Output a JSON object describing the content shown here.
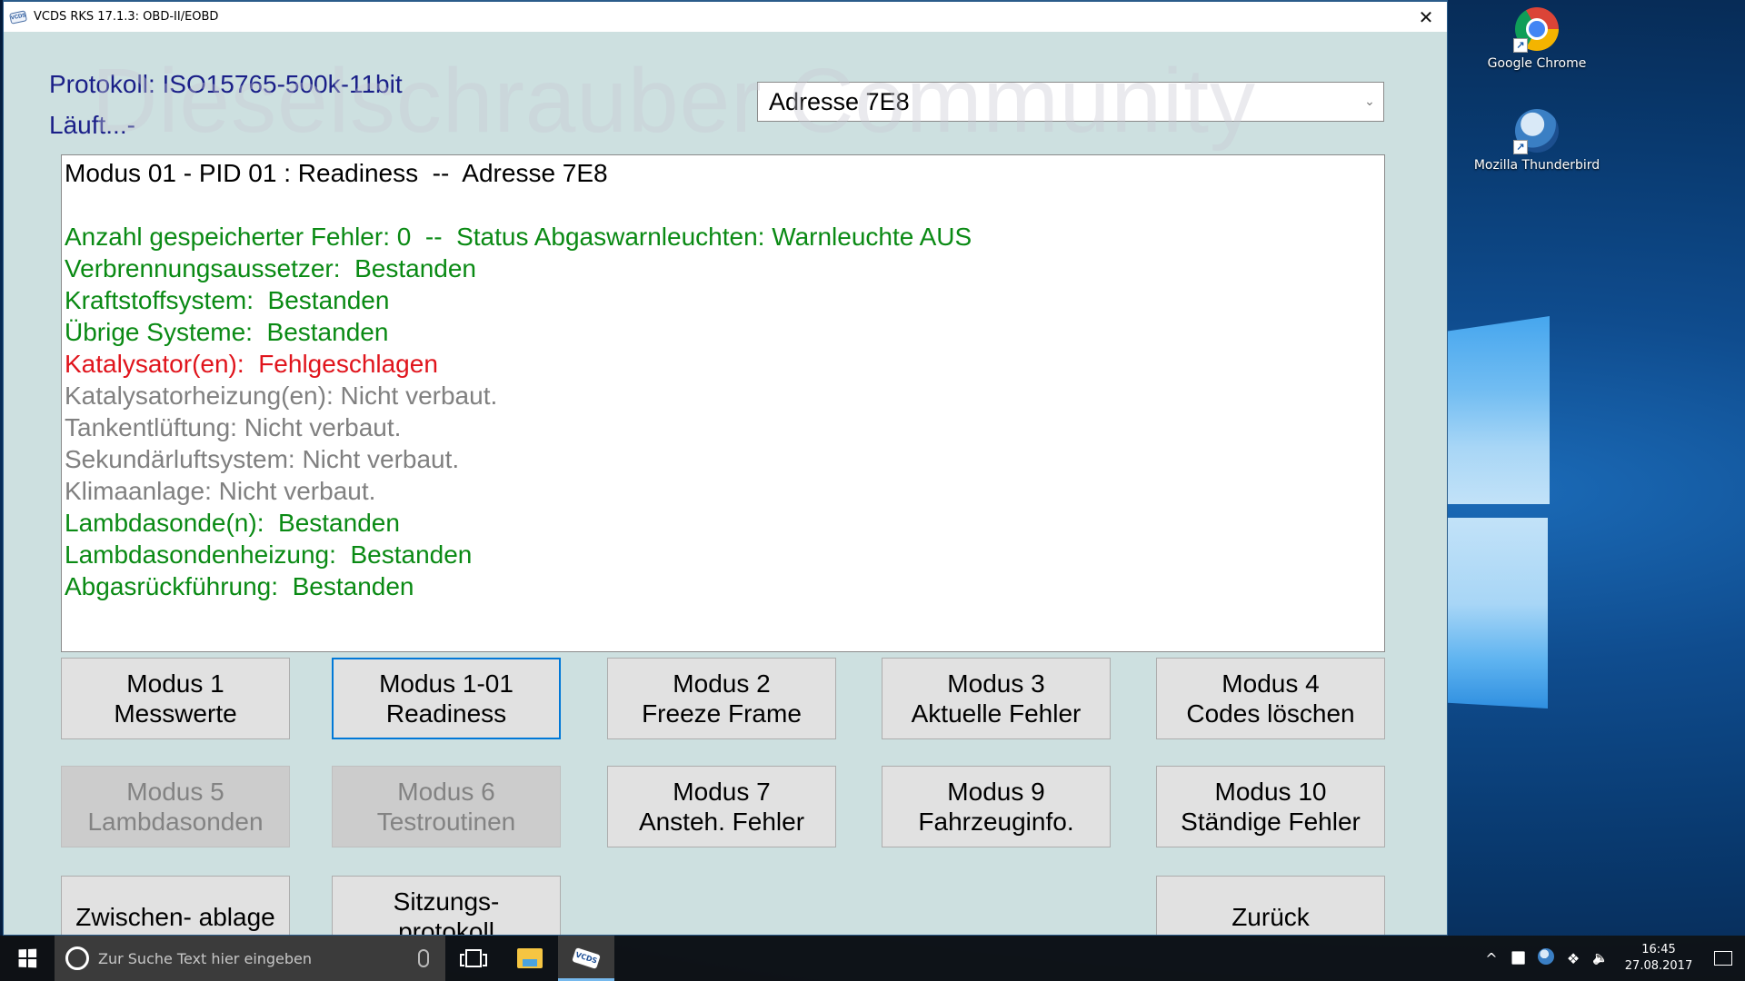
{
  "window": {
    "title": "VCDS RKS 17.1.3:  OBD-II/EOBD",
    "app_icon_text": "VCDS",
    "close_glyph": "✕"
  },
  "watermark": "Dieselschrauber Community",
  "protocol_label": "Protokoll: ISO15765-500k-11bit",
  "status_label": "Läuft...-",
  "address_select": {
    "selected": "Adresse 7E8",
    "chevron_glyph": "⌄"
  },
  "result": {
    "header": "Modus 01 - PID 01 : Readiness  --  Adresse 7E8",
    "lines": [
      {
        "text": "",
        "status": "blank"
      },
      {
        "text": "Anzahl gespeicherter Fehler: 0  --  Status Abgaswarnleuchten: Warnleuchte AUS",
        "status": "ok"
      },
      {
        "text": "Verbrennungsaussetzer:  Bestanden",
        "status": "ok"
      },
      {
        "text": "Kraftstoffsystem:  Bestanden",
        "status": "ok"
      },
      {
        "text": "Übrige Systeme:  Bestanden",
        "status": "ok"
      },
      {
        "text": "Katalysator(en):  Fehlgeschlagen",
        "status": "failed"
      },
      {
        "text": "Katalysatorheizung(en): Nicht verbaut.",
        "status": "not-installed"
      },
      {
        "text": "Tankentlüftung: Nicht verbaut.",
        "status": "not-installed"
      },
      {
        "text": "Sekundärluftsystem: Nicht verbaut.",
        "status": "not-installed"
      },
      {
        "text": "Klimaanlage: Nicht verbaut.",
        "status": "not-installed"
      },
      {
        "text": "Lambdasonde(n):  Bestanden",
        "status": "ok"
      },
      {
        "text": "Lambdasondenheizung:  Bestanden",
        "status": "ok"
      },
      {
        "text": "Abgasrückführung:  Bestanden",
        "status": "ok"
      }
    ],
    "colors": {
      "ok": "#0a8a14",
      "failed": "#e0141c",
      "not-installed": "#808080"
    }
  },
  "buttons": [
    {
      "line1": "Modus 1",
      "line2": "Messwerte",
      "state": "normal"
    },
    {
      "line1": "Modus 1-01",
      "line2": "Readiness",
      "state": "focused"
    },
    {
      "line1": "Modus 2",
      "line2": "Freeze Frame",
      "state": "normal"
    },
    {
      "line1": "Modus 3",
      "line2": "Aktuelle Fehler",
      "state": "normal"
    },
    {
      "line1": "Modus 4",
      "line2": "Codes löschen",
      "state": "normal"
    },
    {
      "line1": "Modus 5",
      "line2": "Lambdasonden",
      "state": "disabled"
    },
    {
      "line1": "Modus 6",
      "line2": "Testroutinen",
      "state": "disabled"
    },
    {
      "line1": "Modus 7",
      "line2": "Ansteh. Fehler",
      "state": "normal"
    },
    {
      "line1": "Modus 9",
      "line2": "Fahrzeuginfo.",
      "state": "normal"
    },
    {
      "line1": "Modus 10",
      "line2": "Ständige Fehler",
      "state": "normal"
    },
    {
      "line1": "Zwischen- ablage",
      "line2": "",
      "state": "normal"
    },
    {
      "line1": "Sitzungs-",
      "line2": "protokoll",
      "state": "normal"
    },
    {
      "line1": "Zurück",
      "line2": "",
      "state": "normal"
    }
  ],
  "desktop": {
    "icons": [
      {
        "label": "Google Chrome",
        "icon": "chrome-icon"
      },
      {
        "label": "Mozilla Thunderbird",
        "icon": "thunderbird-icon"
      }
    ],
    "shortcut_glyph": "↗"
  },
  "taskbar": {
    "search_placeholder": "Zur Suche Text hier eingeben",
    "apps": [
      {
        "name": "task-view",
        "active": false
      },
      {
        "name": "file-explorer",
        "active": false
      },
      {
        "name": "vcds",
        "active": true,
        "icon_text": "VCDS"
      }
    ],
    "tray": {
      "chevron_glyph": "^",
      "wifi_glyph": "📶",
      "volume_glyph": "🔈",
      "dropbox_glyph": "❖"
    },
    "time": "16:45",
    "date": "27.08.2017"
  }
}
